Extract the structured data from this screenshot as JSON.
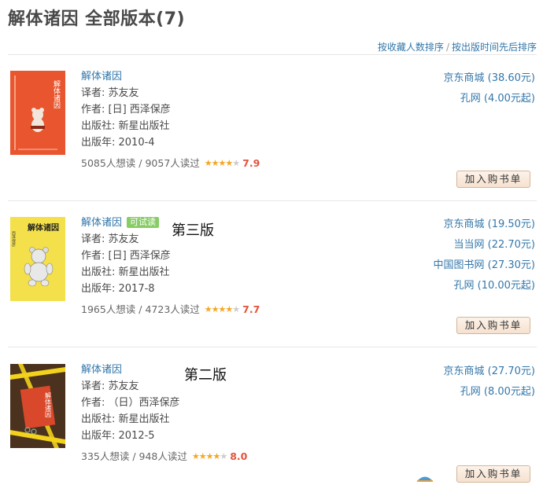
{
  "page": {
    "title": "解体诸因 全部版本(7)",
    "sort_by_collect": "按收藏人数排序",
    "sort_separator": "/",
    "sort_by_date": "按出版时间先后排序"
  },
  "books": [
    {
      "title": "解体诸因",
      "trial_badge": "",
      "edition_note": "",
      "translator": "译者: 苏友友",
      "author": "作者: [日] 西泽保彦",
      "publisher": "出版社: 新星出版社",
      "year": "出版年: 2010-4",
      "stats": "5085人想读 / 9057人读过",
      "stars_filled": 4,
      "score": "7.9",
      "cover_icon": "teddy-bear-red-cover",
      "cover_text": "解体诸因",
      "prices": [
        "京东商城 (38.60元)",
        "孔网 (4.00元起)"
      ],
      "cart_label": "加入购书单"
    },
    {
      "title": "解体诸因",
      "trial_badge": "可试读",
      "edition_note": "第三版",
      "translator": "译者: 苏友友",
      "author": "作者: [日] 西泽保彦",
      "publisher": "出版社: 新星出版社",
      "year": "出版年: 2017-8",
      "stats": "1965人想读 / 4723人读过",
      "stars_filled": 4,
      "score": "7.7",
      "cover_icon": "teddy-bear-yellow-cover",
      "cover_text": "解体诸因",
      "prices": [
        "京东商城 (19.50元)",
        "当当网 (22.70元)",
        "中国图书网 (27.30元)",
        "孔网 (10.00元起)"
      ],
      "cart_label": "加入购书单"
    },
    {
      "title": "解体诸因",
      "trial_badge": "",
      "edition_note": "第二版",
      "translator": "译者: 苏友友",
      "author": "作者: （日）西泽保彦",
      "publisher": "出版社: 新星出版社",
      "year": "出版年: 2012-5",
      "stats": "335人想读 / 948人读过",
      "stars_filled": 4,
      "score": "8.0",
      "cover_icon": "crime-tape-dark-cover",
      "cover_text": "解体诸因",
      "prices": [
        "京东商城 (27.70元)",
        "孔网 (8.00元起)"
      ],
      "cart_label": "加入购书单"
    }
  ],
  "colors": {
    "link": "#3377aa",
    "score": "#e4543b",
    "star": "#f5a623",
    "badge": "#88cc66"
  }
}
